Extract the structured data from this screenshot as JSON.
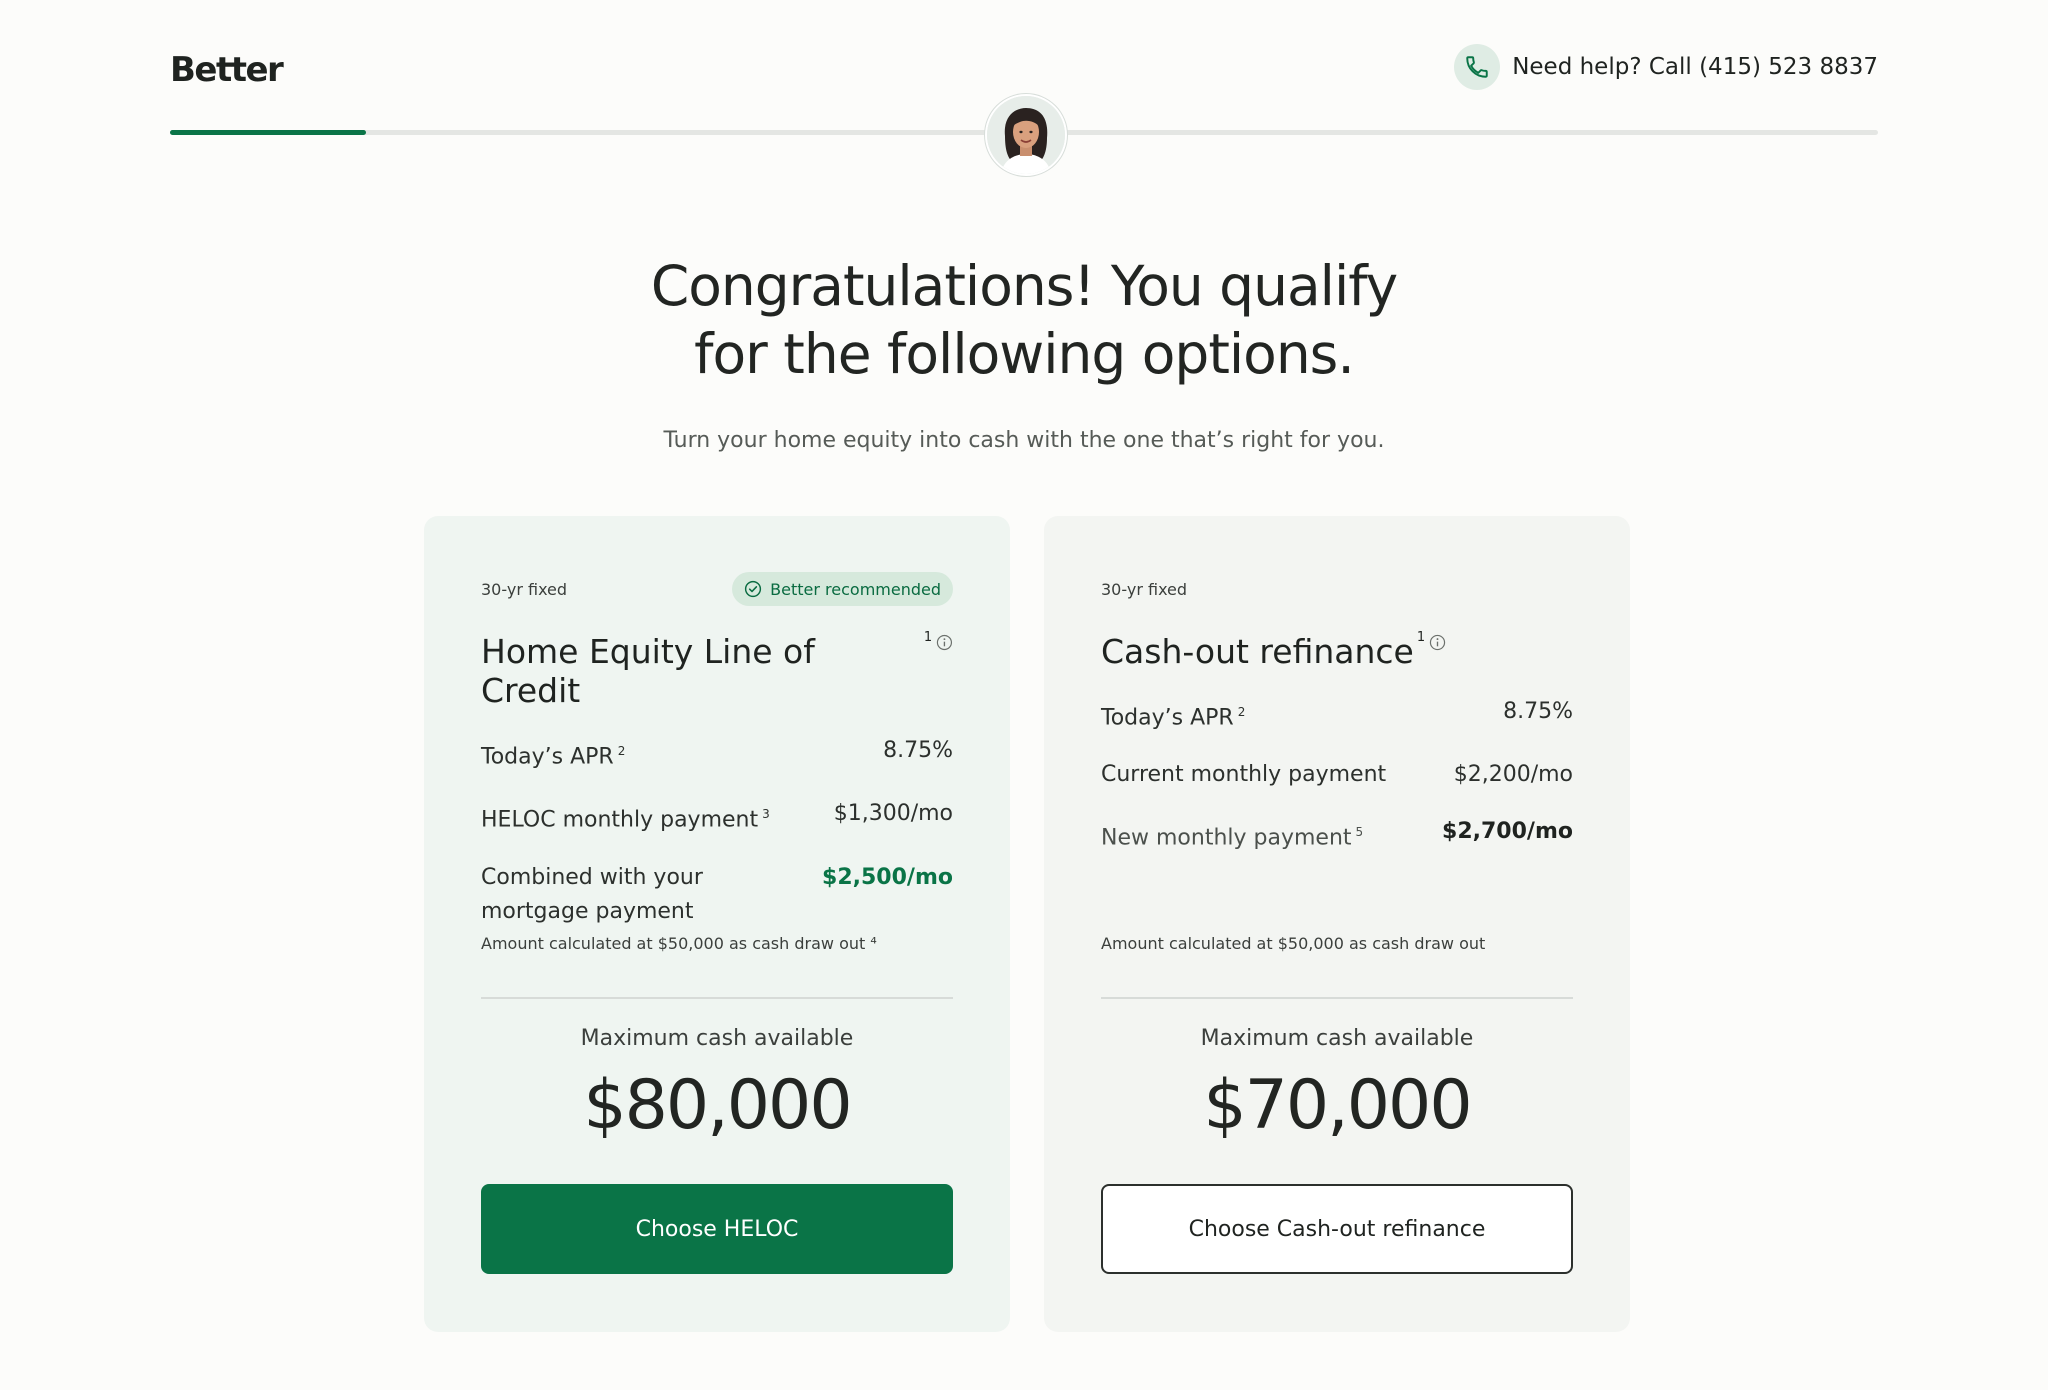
{
  "header": {
    "logo": "Better",
    "help_text": "Need help? Call (415) 523 8837",
    "progress_fraction": 0.115
  },
  "hero": {
    "title_line1": "Congratulations! You qualify",
    "title_line2": "for the following options.",
    "subtitle": "Turn your home equity into cash with the one that’s right for you."
  },
  "cards": [
    {
      "term": "30-yr fixed",
      "badge": "Better recommended",
      "title": "Home Equity Line of Credit",
      "title_sup": "1",
      "rows": [
        {
          "label": "Today’s APR",
          "sup": "2",
          "value": "8.75%"
        },
        {
          "label": "HELOC monthly payment",
          "sup": "3",
          "value": "$1,300/mo"
        },
        {
          "label": "Combined with your mortgage payment",
          "value": "$2,500/mo"
        }
      ],
      "note": "Amount calculated at $50,000 as cash draw out ⁴",
      "max_label": "Maximum cash available",
      "max_value": "$80,000",
      "cta": "Choose HELOC"
    },
    {
      "term": "30-yr fixed",
      "title": "Cash-out refinance",
      "title_sup": "1",
      "rows": [
        {
          "label": "Today’s APR",
          "sup": "2",
          "value": "8.75%"
        },
        {
          "label": "Current monthly payment",
          "value": "$2,200/mo"
        },
        {
          "label": "New monthly payment",
          "sup": "5",
          "value": "$2,700/mo"
        }
      ],
      "note": "Amount calculated at $50,000 as cash draw out",
      "max_label": "Maximum cash available",
      "max_value": "$70,000",
      "cta": "Choose Cash-out refinance"
    }
  ],
  "colors": {
    "brand_green": "#0a7447",
    "background": "#fcfcfa"
  }
}
